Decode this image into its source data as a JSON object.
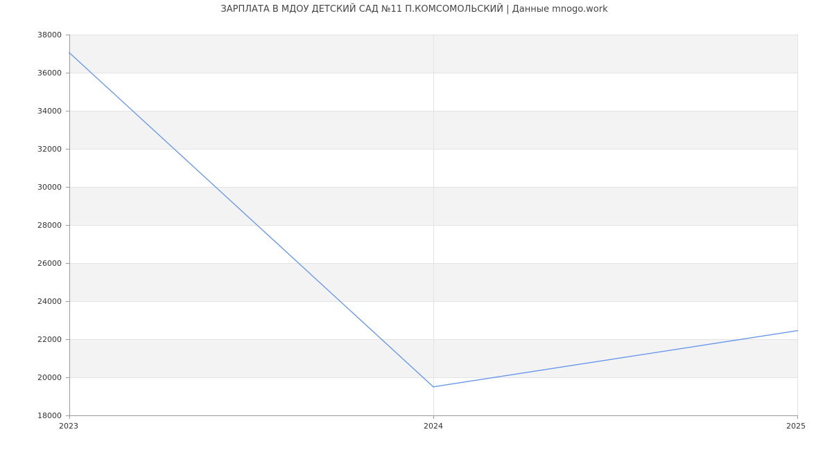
{
  "chart_data": {
    "type": "line",
    "title": "ЗАРПЛАТА В МДОУ ДЕТСКИЙ САД №11 П.КОМСОМОЛЬСКИЙ | Данные mnogo.work",
    "xlabel": "",
    "ylabel": "",
    "x": [
      "2023",
      "2024",
      "2025"
    ],
    "series": [
      {
        "values": [
          37050,
          19500,
          22450
        ]
      }
    ],
    "ylim": [
      18000,
      38000
    ],
    "yticks": [
      "18000",
      "20000",
      "22000",
      "24000",
      "26000",
      "28000",
      "30000",
      "32000",
      "34000",
      "36000",
      "38000"
    ],
    "grid": true,
    "line_color": "#6495ed",
    "band_color": "#f3f3f3"
  }
}
